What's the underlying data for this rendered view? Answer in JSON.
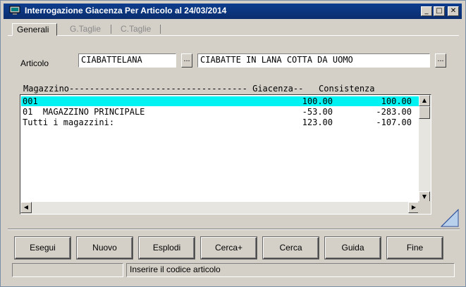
{
  "window": {
    "title": "Interrogazione Giacenza Per Articolo al 24/03/2014",
    "minimize_glyph": "_",
    "maximize_glyph": "□",
    "close_glyph": "✕"
  },
  "tabs": [
    {
      "label": "Generali",
      "active": true
    },
    {
      "label": "G.Taglie",
      "active": false
    },
    {
      "label": "C.Taglie",
      "active": false
    }
  ],
  "form": {
    "articolo_label": "Articolo",
    "articolo_code": "CIABATTELANA",
    "articolo_description": "CIABATTE IN LANA COTTA DA UOMO",
    "lookup_button": "...",
    "description_button": "..."
  },
  "list": {
    "header": "Magazzino----------------------------------- Giacenza--   Consistenza",
    "rows": [
      {
        "magazzino": "001",
        "giacenza": "100.00",
        "consistenza": "100.00",
        "selected": true
      },
      {
        "magazzino": "01  MAGAZZINO PRINCIPALE",
        "giacenza": "-53.00",
        "consistenza": "-283.00",
        "selected": false
      },
      {
        "magazzino": "Tutti i magazzini:",
        "giacenza": "123.00",
        "consistenza": "-107.00",
        "selected": false
      }
    ]
  },
  "buttons": {
    "esegui": "Esegui",
    "nuovo": "Nuovo",
    "esplodi": "Esplodi",
    "cerca_plus": "Cerca+",
    "cerca": "Cerca",
    "guida": "Guida",
    "fine": "Fine"
  },
  "statusbar": {
    "left": "",
    "message": "Inserire il codice articolo"
  },
  "colors": {
    "titlebar": "#0a2e6e",
    "selection": "#00f2f2",
    "face": "#d4d0c8"
  }
}
